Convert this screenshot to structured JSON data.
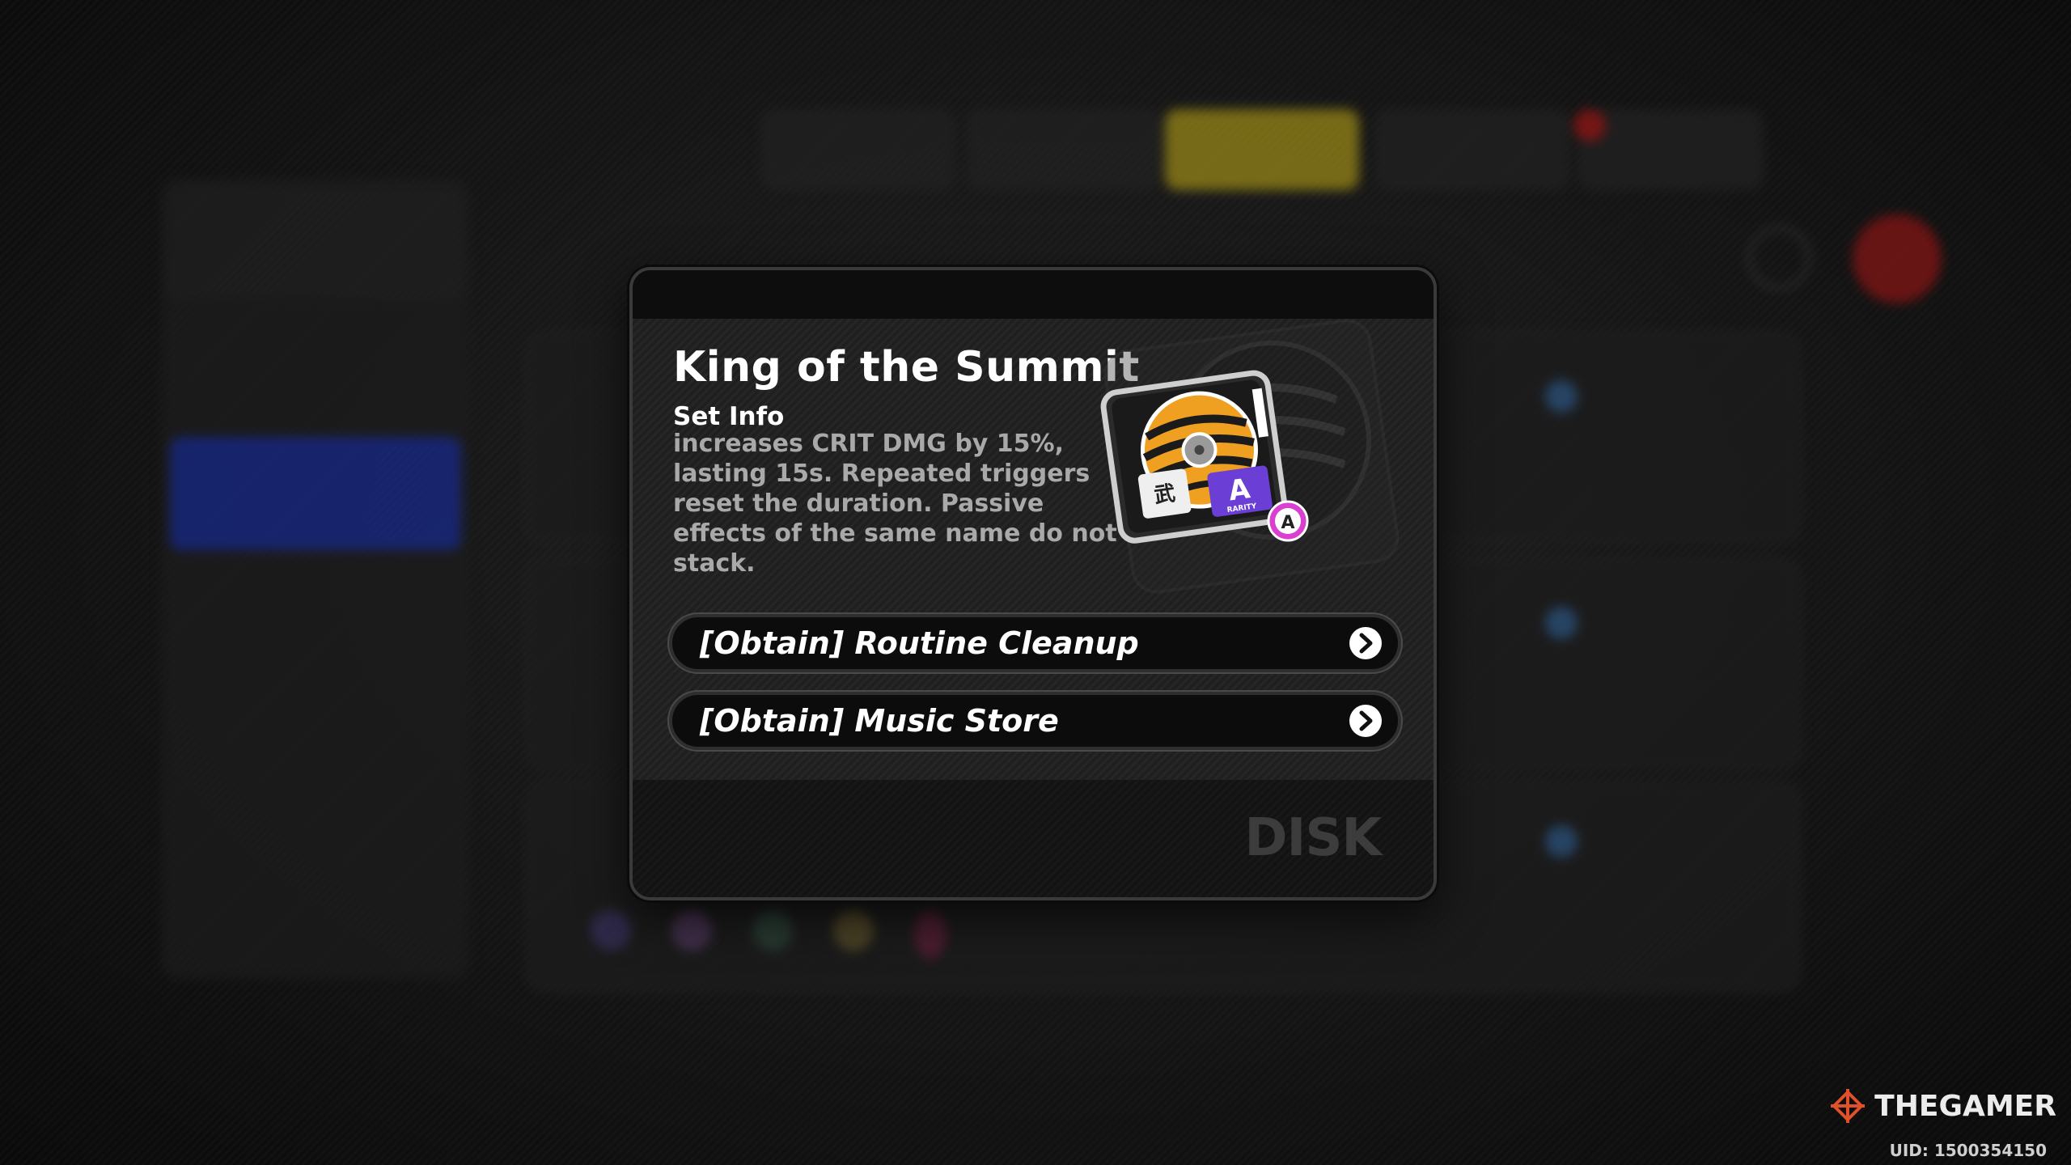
{
  "modal": {
    "title": "King of the Summit",
    "set_info_label": "Set Info",
    "description": "increases CRIT DMG by 15%, lasting 15s. Repeated triggers reset the duration. Passive effects of the same name do not stack.",
    "rarity_badge": "A",
    "disc_rarity_label": "RARITY",
    "obtain_options": [
      {
        "label": "[Obtain] Routine Cleanup",
        "icon": "chevron-right-icon"
      },
      {
        "label": "[Obtain] Music Store",
        "icon": "chevron-right-icon"
      }
    ],
    "footer_label": "DISK"
  },
  "watermark": {
    "brand": "THEGAMER",
    "uid": "UID: 1500354150"
  },
  "colors": {
    "accent_yellow": "#c9b21f",
    "side_active_blue": "#2038b8",
    "rarity_pink": "#d93fd0",
    "disc_orange": "#f0a020"
  }
}
